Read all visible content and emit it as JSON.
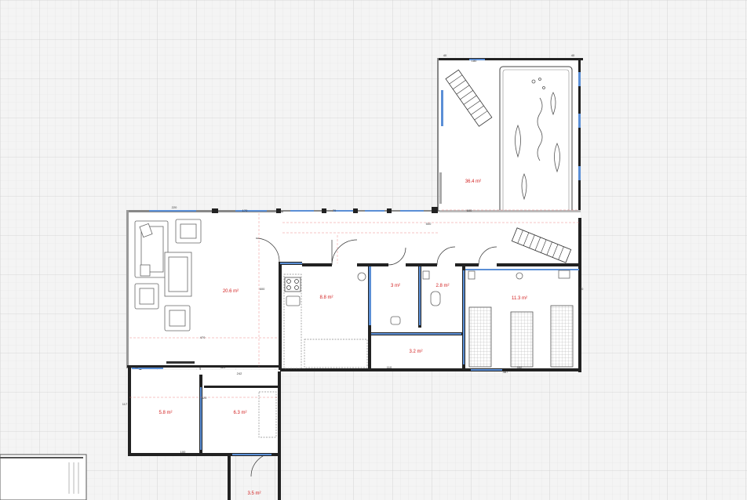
{
  "plan": {
    "rooms": [
      {
        "id": "terrace",
        "area": "36.4 m²"
      },
      {
        "id": "living",
        "area": "20.6 m²"
      },
      {
        "id": "kitchen",
        "area": "8.8 m²"
      },
      {
        "id": "wc",
        "area": "3 m²"
      },
      {
        "id": "bath",
        "area": "2.8 m²"
      },
      {
        "id": "bedroom",
        "area": "11.3 m²"
      },
      {
        "id": "corridor",
        "area": "3.2 m²"
      },
      {
        "id": "room-a",
        "area": "5.8 m²"
      },
      {
        "id": "room-b",
        "area": "6.3 m²"
      },
      {
        "id": "room-c",
        "area": "3.5 m²"
      }
    ],
    "dimensions": {
      "d01": "40",
      "d02": "180",
      "d03": "40",
      "d04": "220",
      "d05": "170",
      "d06": "70",
      "d07": "500",
      "d08": "600",
      "d09": "270",
      "d10": "470",
      "d11": "600",
      "d12": "320",
      "d13": "242",
      "d14": "487",
      "d15": "40",
      "d16": "117",
      "d17": "420",
      "d18": "332",
      "d19": "110",
      "d20": "100"
    },
    "colors": {
      "background": "#f4f4f4",
      "grid_minor": "#e2e2e2",
      "grid_major": "#d0d0d0",
      "wall": "#222222",
      "window": "#5b8fd6",
      "area_label": "#d21f1f"
    }
  }
}
